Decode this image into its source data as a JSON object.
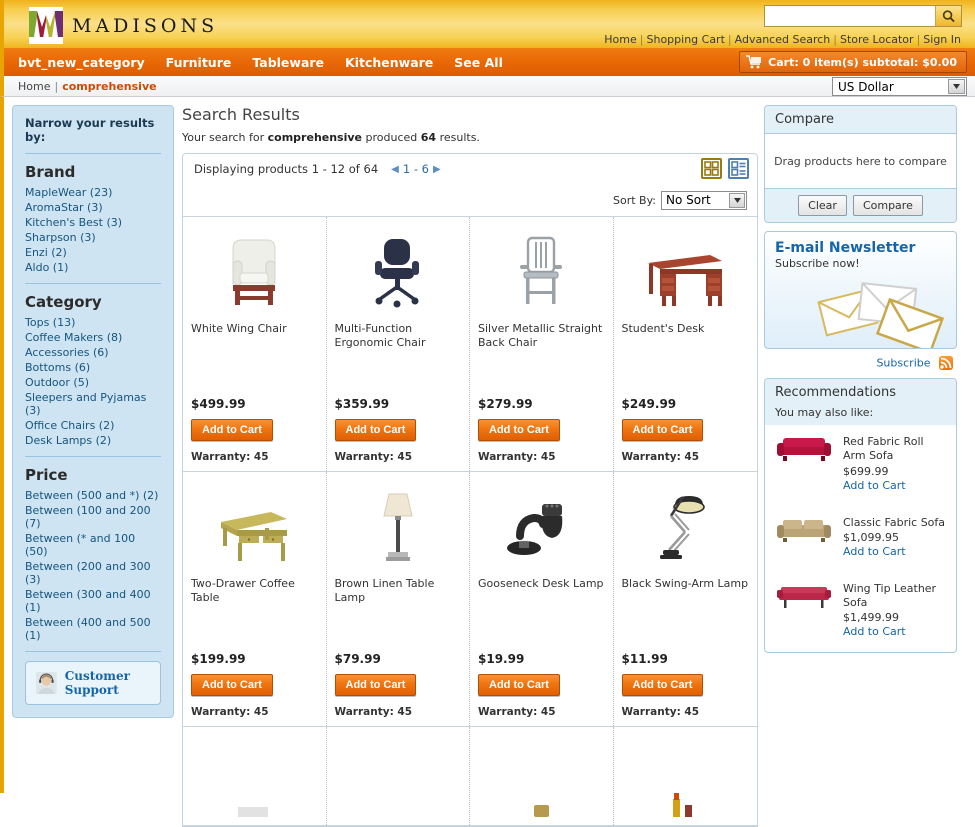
{
  "brand": {
    "name": "MADISONS"
  },
  "search": {
    "value": "",
    "placeholder": "",
    "icon": "search-icon"
  },
  "toplinks": [
    {
      "label": "Home"
    },
    {
      "label": "Shopping Cart"
    },
    {
      "label": "Advanced Search"
    },
    {
      "label": "Store Locator"
    },
    {
      "label": "Sign In"
    }
  ],
  "nav": {
    "items": [
      {
        "label": "bvt_new_category"
      },
      {
        "label": "Furniture"
      },
      {
        "label": "Tableware"
      },
      {
        "label": "Kitchenware"
      },
      {
        "label": "See All"
      }
    ],
    "cart_label": "Cart: 0 item(s) subtotal: $0.00",
    "cart_icon": "shopping-cart-icon"
  },
  "breadcrumb": {
    "home": "Home",
    "separator": "|",
    "current": "comprehensive"
  },
  "currency": {
    "selected": "US Dollar"
  },
  "sidebar": {
    "heading": "Narrow your results by:",
    "groups": [
      {
        "title": "Brand",
        "items": [
          {
            "label": "MapleWear (23)"
          },
          {
            "label": "AromaStar (3)"
          },
          {
            "label": "Kitchen's Best (3)"
          },
          {
            "label": "Sharpson (3)"
          },
          {
            "label": "Enzi (2)"
          },
          {
            "label": "Aldo (1)"
          }
        ]
      },
      {
        "title": "Category",
        "items": [
          {
            "label": "Tops (13)"
          },
          {
            "label": "Coffee Makers (8)"
          },
          {
            "label": "Accessories (6)"
          },
          {
            "label": "Bottoms (6)"
          },
          {
            "label": "Outdoor (5)"
          },
          {
            "label": "Sleepers and Pyjamas (3)"
          },
          {
            "label": "Office Chairs (2)"
          },
          {
            "label": "Desk Lamps (2)"
          }
        ]
      },
      {
        "title": "Price",
        "items": [
          {
            "label": "Between (500 and *) (2)"
          },
          {
            "label": "Between (100 and 200 (7)"
          },
          {
            "label": "Between (* and 100 (50)"
          },
          {
            "label": "Between (200 and 300 (3)"
          },
          {
            "label": "Between (300 and 400 (1)"
          },
          {
            "label": "Between (400 and 500 (1)"
          }
        ]
      }
    ],
    "support_label": "Customer Support"
  },
  "results": {
    "title": "Search Results",
    "summary_prefix": "Your search for",
    "query": "comprehensive",
    "summary_mid": "produced",
    "count": "64",
    "summary_suffix": "results.",
    "displaying": "Displaying products 1 - 12 of 64",
    "page_range": "1 - 6",
    "sort_label": "Sort By:",
    "sort_value": "No Sort",
    "view_grid_icon": "grid-view-icon",
    "view_list_icon": "list-view-icon",
    "add_to_cart": "Add to Cart"
  },
  "products": [
    {
      "name": "White Wing Chair",
      "price": "$499.99",
      "warranty": "Warranty: 45",
      "image": "white-wing-chair-image"
    },
    {
      "name": "Multi-Function Ergonomic Chair",
      "price": "$359.99",
      "warranty": "Warranty: 45",
      "image": "ergonomic-chair-image"
    },
    {
      "name": "Silver Metallic Straight Back Chair",
      "price": "$279.99",
      "warranty": "Warranty: 45",
      "image": "metallic-chair-image"
    },
    {
      "name": "Student's Desk",
      "price": "$249.99",
      "warranty": "Warranty: 45",
      "image": "student-desk-image"
    },
    {
      "name": "Two-Drawer Coffee Table",
      "price": "$199.99",
      "warranty": "Warranty: 45",
      "image": "coffee-table-image"
    },
    {
      "name": "Brown Linen Table Lamp",
      "price": "$79.99",
      "warranty": "Warranty: 45",
      "image": "table-lamp-image"
    },
    {
      "name": "Gooseneck Desk Lamp",
      "price": "$19.99",
      "warranty": "Warranty: 45",
      "image": "gooseneck-lamp-image"
    },
    {
      "name": "Black Swing-Arm Lamp",
      "price": "$11.99",
      "warranty": "Warranty: 45",
      "image": "swing-arm-lamp-image"
    }
  ],
  "compare": {
    "title": "Compare",
    "dropzone": "Drag products here to compare",
    "clear": "Clear",
    "compare": "Compare"
  },
  "newsletter": {
    "title": "E-mail Newsletter",
    "subtitle": "Subscribe now!",
    "subscribe": "Subscribe",
    "rss_icon": "rss-icon",
    "envelopes_icon": "envelopes-image"
  },
  "recommendations": {
    "title": "Recommendations",
    "subtitle": "You may also like:",
    "add_to_cart": "Add to Cart",
    "items": [
      {
        "name": "Red Fabric Roll Arm Sofa",
        "price": "$699.99",
        "image": "red-sofa-image"
      },
      {
        "name": "Classic Fabric Sofa",
        "price": "$1,099.95",
        "image": "tan-sofa-image"
      },
      {
        "name": "Wing Tip Leather Sofa",
        "price": "$1,499.99",
        "image": "crimson-sofa-image"
      }
    ]
  },
  "colors": {
    "brand_orange": "#e96a06",
    "brand_gold": "#f3c43c",
    "link_blue": "#15557f"
  }
}
